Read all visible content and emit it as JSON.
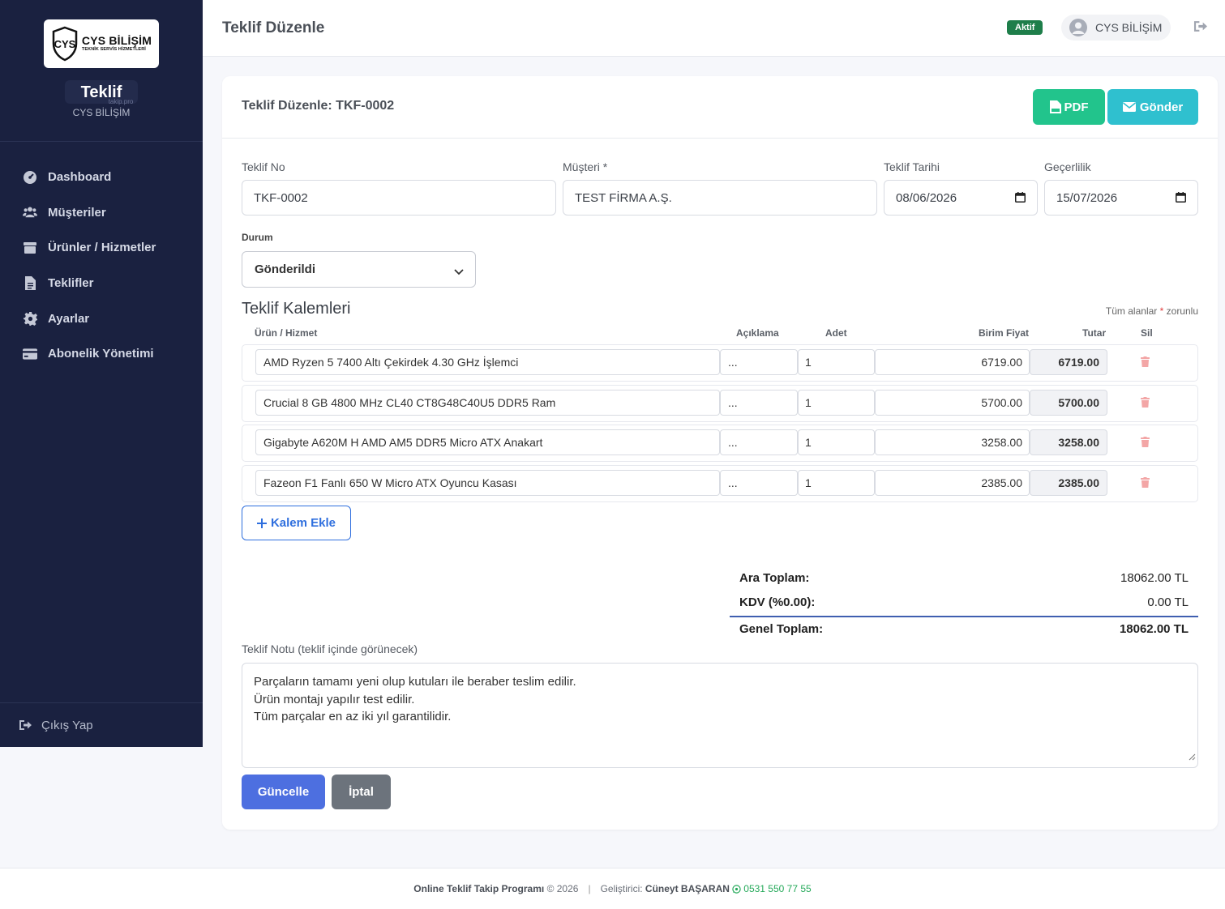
{
  "sidebar": {
    "logo": {
      "main": "CYS BİLİŞİM",
      "sub": "TEKNİK SERVİS HİZMETLERİ"
    },
    "app_name": "Teklif",
    "app_domain": "takip.pro",
    "company": "CYS BİLİŞİM",
    "items": [
      {
        "label": "Dashboard",
        "icon": "dashboard-icon"
      },
      {
        "label": "Müşteriler",
        "icon": "users-icon"
      },
      {
        "label": "Ürünler / Hizmetler",
        "icon": "box-icon"
      },
      {
        "label": "Teklifler",
        "icon": "document-icon"
      },
      {
        "label": "Ayarlar",
        "icon": "gear-icon"
      },
      {
        "label": "Abonelik Yönetimi",
        "icon": "credit-card-icon"
      }
    ],
    "logout": "Çıkış Yap"
  },
  "header": {
    "title": "Teklif Düzenle",
    "status": "Aktif",
    "user": "CYS BİLİŞİM"
  },
  "card": {
    "title": "Teklif Düzenle: TKF-0002",
    "pdf_label": "PDF",
    "send_label": "Gönder"
  },
  "form": {
    "no_label": "Teklif No",
    "no_value": "TKF-0002",
    "customer_label": "Müşteri *",
    "customer_value": "TEST FİRMA A.Ş.",
    "date_label": "Teklif Tarihi",
    "date_value": "08/06/2026",
    "valid_label": "Geçerlilik",
    "valid_value": "15/07/2026",
    "status_label": "Durum",
    "status_value": "Gönderildi"
  },
  "items": {
    "title": "Teklif Kalemleri",
    "required_note": "Tüm alanlar",
    "required_star": "*",
    "required_suffix": "zorunlu",
    "headers": {
      "product": "Ürün / Hizmet",
      "desc": "Açıklama",
      "qty": "Adet",
      "price": "Birim Fiyat",
      "total": "Tutar",
      "delete": "Sil"
    },
    "rows": [
      {
        "product": "AMD Ryzen 5 7400 Altı Çekirdek 4.30 GHz İşlemci",
        "desc": "...",
        "qty": "1",
        "price": "6719.00",
        "total": "6719.00"
      },
      {
        "product": "Crucial 8 GB 4800 MHz CL40 CT8G48C40U5 DDR5 Ram",
        "desc": "...",
        "qty": "1",
        "price": "5700.00",
        "total": "5700.00"
      },
      {
        "product": "Gigabyte A620M H AMD AM5 DDR5 Micro ATX Anakart",
        "desc": "...",
        "qty": "1",
        "price": "3258.00",
        "total": "3258.00"
      },
      {
        "product": "Fazeon F1 Fanlı 650 W Micro ATX Oyuncu Kasası",
        "desc": "...",
        "qty": "1",
        "price": "2385.00",
        "total": "2385.00"
      }
    ],
    "add_label": "Kalem Ekle"
  },
  "totals": {
    "subtotal_label": "Ara Toplam:",
    "subtotal_value": "18062.00 TL",
    "vat_label": "KDV (%0.00):",
    "vat_value": "0.00 TL",
    "grand_label": "Genel Toplam:",
    "grand_value": "18062.00 TL"
  },
  "note": {
    "label": "Teklif Notu (teklif içinde görünecek)",
    "lines": [
      "Parçaların tamamı yeni olup kutuları ile beraber teslim edilir.",
      "Ürün montajı yapılır test edilir.",
      "Tüm parçalar en az iki yıl garantilidir."
    ]
  },
  "actions": {
    "update": "Güncelle",
    "cancel": "İptal"
  },
  "footer": {
    "app": "Online Teklif Takip Programı",
    "year": "© 2026",
    "dev_label": "Geliştirici:",
    "dev_name": "Cüneyt BAŞARAN",
    "phone": "0531 550 77 55"
  },
  "colors": {
    "sidebar": "#1a2140",
    "success": "#22c48c",
    "info": "#2fc0cf",
    "primary": "#4d6fe0",
    "secondary": "#6c737c",
    "badge": "#1e7e4a"
  }
}
